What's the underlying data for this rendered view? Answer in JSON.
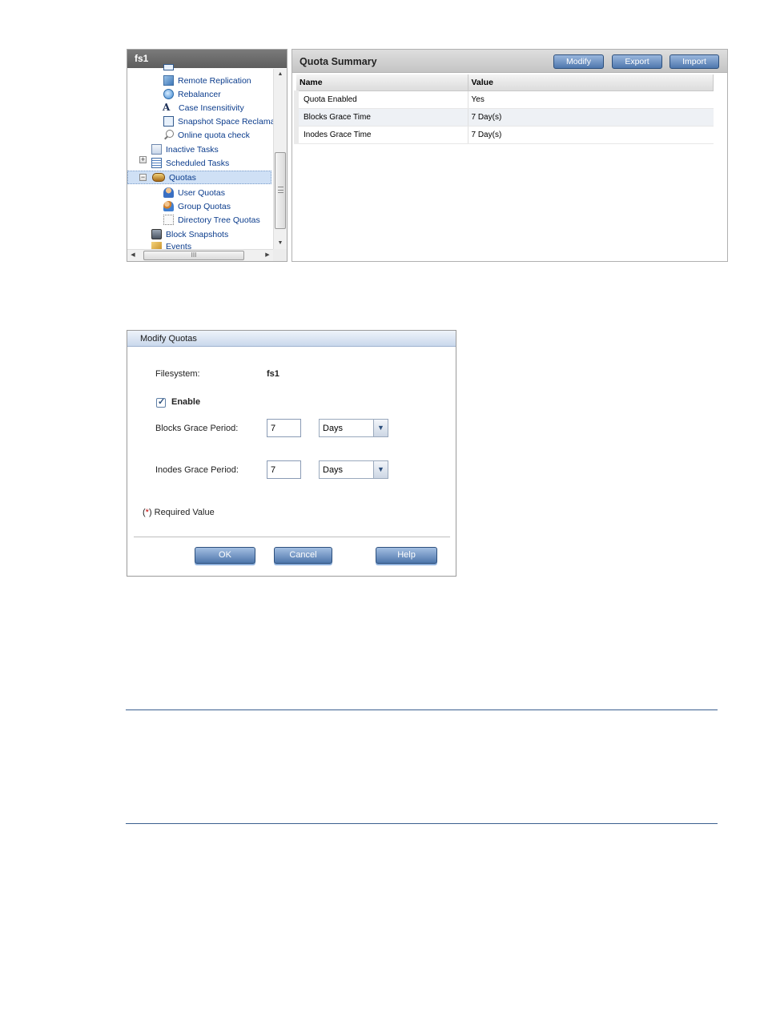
{
  "tree": {
    "title": "fs1",
    "items": [
      {
        "label": "Remote Replication",
        "icon": "remote-replication-icon"
      },
      {
        "label": "Rebalancer",
        "icon": "rebalancer-icon"
      },
      {
        "label": "Case Insensitivity",
        "icon": "case-insensitivity-icon"
      },
      {
        "label": "Snapshot Space Reclama",
        "icon": "snapshot-space-icon"
      },
      {
        "label": "Online quota check",
        "icon": "magnifier-icon"
      },
      {
        "label": "Inactive Tasks",
        "icon": "inactive-tasks-icon"
      },
      {
        "label": "Scheduled Tasks",
        "icon": "scheduled-tasks-icon"
      },
      {
        "label": "Quotas",
        "icon": "quotas-icon",
        "selected": true
      },
      {
        "label": "User Quotas",
        "icon": "user-icon"
      },
      {
        "label": "Group Quotas",
        "icon": "group-icon"
      },
      {
        "label": "Directory Tree Quotas",
        "icon": "directory-tree-icon"
      },
      {
        "label": "Block Snapshots",
        "icon": "block-snapshots-icon"
      },
      {
        "label": "Events",
        "icon": "events-icon"
      }
    ],
    "expand_plus": "+",
    "expand_minus": "−",
    "hscroll_grip": "III"
  },
  "summary": {
    "title": "Quota Summary",
    "buttons": {
      "modify": "Modify",
      "export": "Export",
      "import": "Import"
    },
    "columns": {
      "name": "Name",
      "value": "Value"
    },
    "rows": [
      {
        "name": "Quota Enabled",
        "value": "Yes"
      },
      {
        "name": "Blocks Grace Time",
        "value": "7 Day(s)"
      },
      {
        "name": "Inodes Grace Time",
        "value": "7 Day(s)"
      }
    ]
  },
  "dialog": {
    "title": "Modify Quotas",
    "filesystem_label": "Filesystem:",
    "filesystem_value": "fs1",
    "enable_label": "Enable",
    "enable_checked": true,
    "blocks_label": "Blocks Grace Period:",
    "blocks_value": "7",
    "blocks_unit": "Days",
    "inodes_label": "Inodes Grace Period:",
    "inodes_value": "7",
    "inodes_unit": "Days",
    "required_open": "(",
    "required_star": "*",
    "required_close": ")",
    "required_label": " Required Value",
    "buttons": {
      "ok": "OK",
      "cancel": "Cancel",
      "help": "Help"
    }
  },
  "colors": {
    "accent": "#4f77ad",
    "selection": "#cfe0f5",
    "rule": "#3a5f8f",
    "required": "#c00000"
  }
}
